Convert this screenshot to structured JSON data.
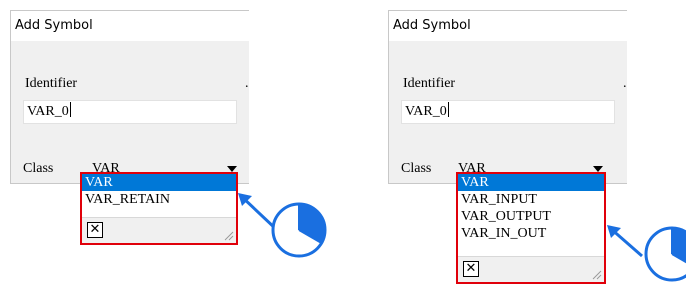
{
  "colors": {
    "highlight": "#e0000a",
    "selection": "#0078d7",
    "callout": "#1a6fe0"
  },
  "panels": [
    {
      "title": "Add Symbol",
      "identifier_label": "Identifier",
      "identifier_value": "VAR_0",
      "class_label": "Class",
      "class_value": "VAR",
      "options": [
        "VAR",
        "VAR_RETAIN"
      ],
      "selected_option": "VAR",
      "close_glyph": "✕",
      "annotation_icon": "pie-clock-icon"
    },
    {
      "title": "Add Symbol",
      "identifier_label": "Identifier",
      "identifier_value": "VAR_0",
      "class_label": "Class",
      "class_value": "VAR",
      "options": [
        "VAR",
        "VAR_INPUT",
        "VAR_OUTPUT",
        "VAR_IN_OUT"
      ],
      "selected_option": "VAR",
      "close_glyph": "✕",
      "annotation_icon": "pie-clock-icon"
    }
  ]
}
